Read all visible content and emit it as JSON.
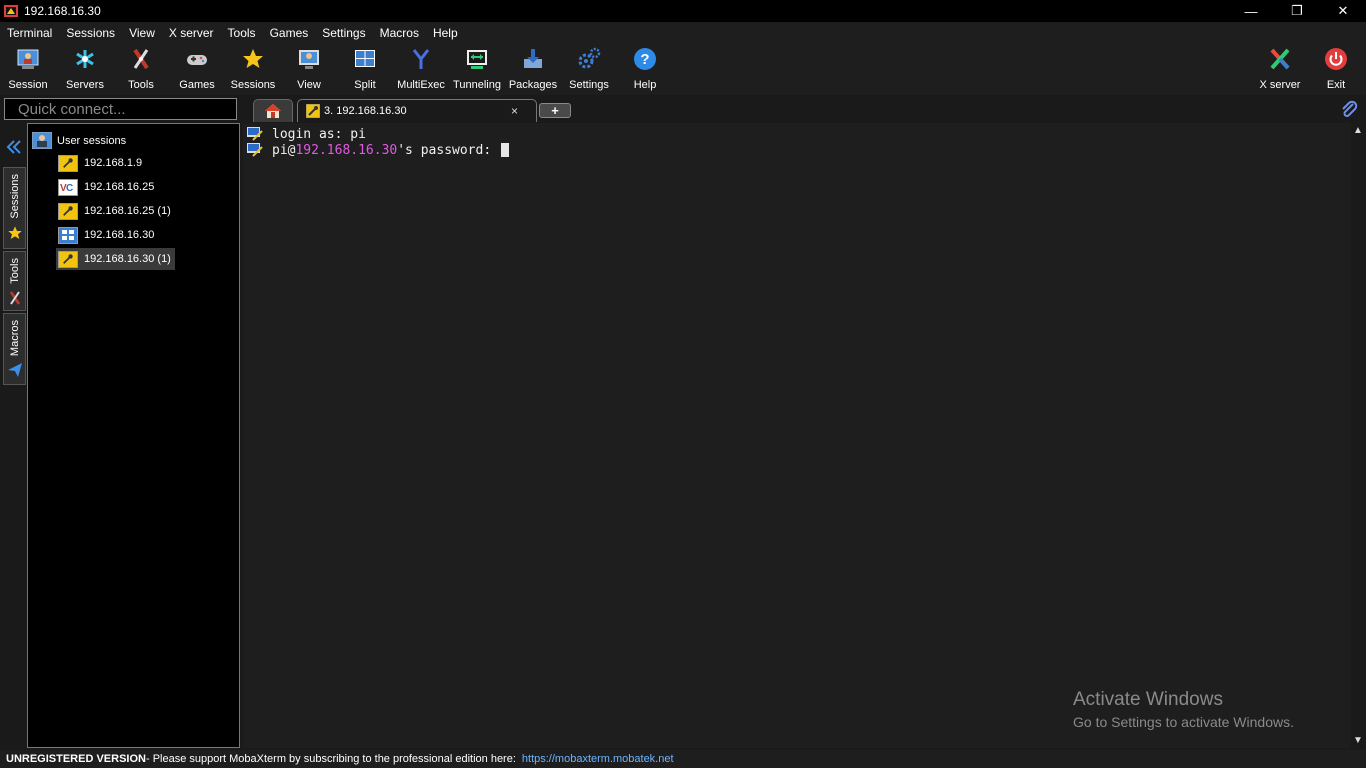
{
  "window": {
    "title": "192.168.16.30"
  },
  "menu": [
    "Terminal",
    "Sessions",
    "View",
    "X server",
    "Tools",
    "Games",
    "Settings",
    "Macros",
    "Help"
  ],
  "toolbar": {
    "session": "Session",
    "servers": "Servers",
    "tools": "Tools",
    "games": "Games",
    "sessions": "Sessions",
    "view": "View",
    "split": "Split",
    "multiexec": "MultiExec",
    "tunneling": "Tunneling",
    "packages": "Packages",
    "settings": "Settings",
    "help": "Help",
    "xserver": "X server",
    "exit": "Exit"
  },
  "quick_connect": {
    "placeholder": "Quick connect..."
  },
  "tabs": {
    "active_label": "3. 192.168.16.30",
    "close": "×"
  },
  "side_tabs": {
    "sessions": "Sessions",
    "tools": "Tools",
    "macros": "Macros"
  },
  "sessions_panel": {
    "root": "User sessions",
    "items": [
      "192.168.1.9",
      "192.168.16.25",
      "192.168.16.25 (1)",
      "192.168.16.30",
      "192.168.16.30 (1)"
    ]
  },
  "terminal": {
    "line1": "login as: pi",
    "line2_user": "pi@",
    "line2_host": "192.168.16.30",
    "line2_rest": "'s password: "
  },
  "watermark": {
    "title": "Activate Windows",
    "subtitle": "Go to Settings to activate Windows."
  },
  "status": {
    "bold": "UNREGISTERED VERSION",
    "text": " -  Please support MobaXterm by subscribing to the professional edition here:",
    "link": "https://mobaxterm.mobatek.net"
  },
  "colors": {
    "host": "#e05ae0",
    "link": "#6cb4ff",
    "background": "#1e1e1e"
  }
}
